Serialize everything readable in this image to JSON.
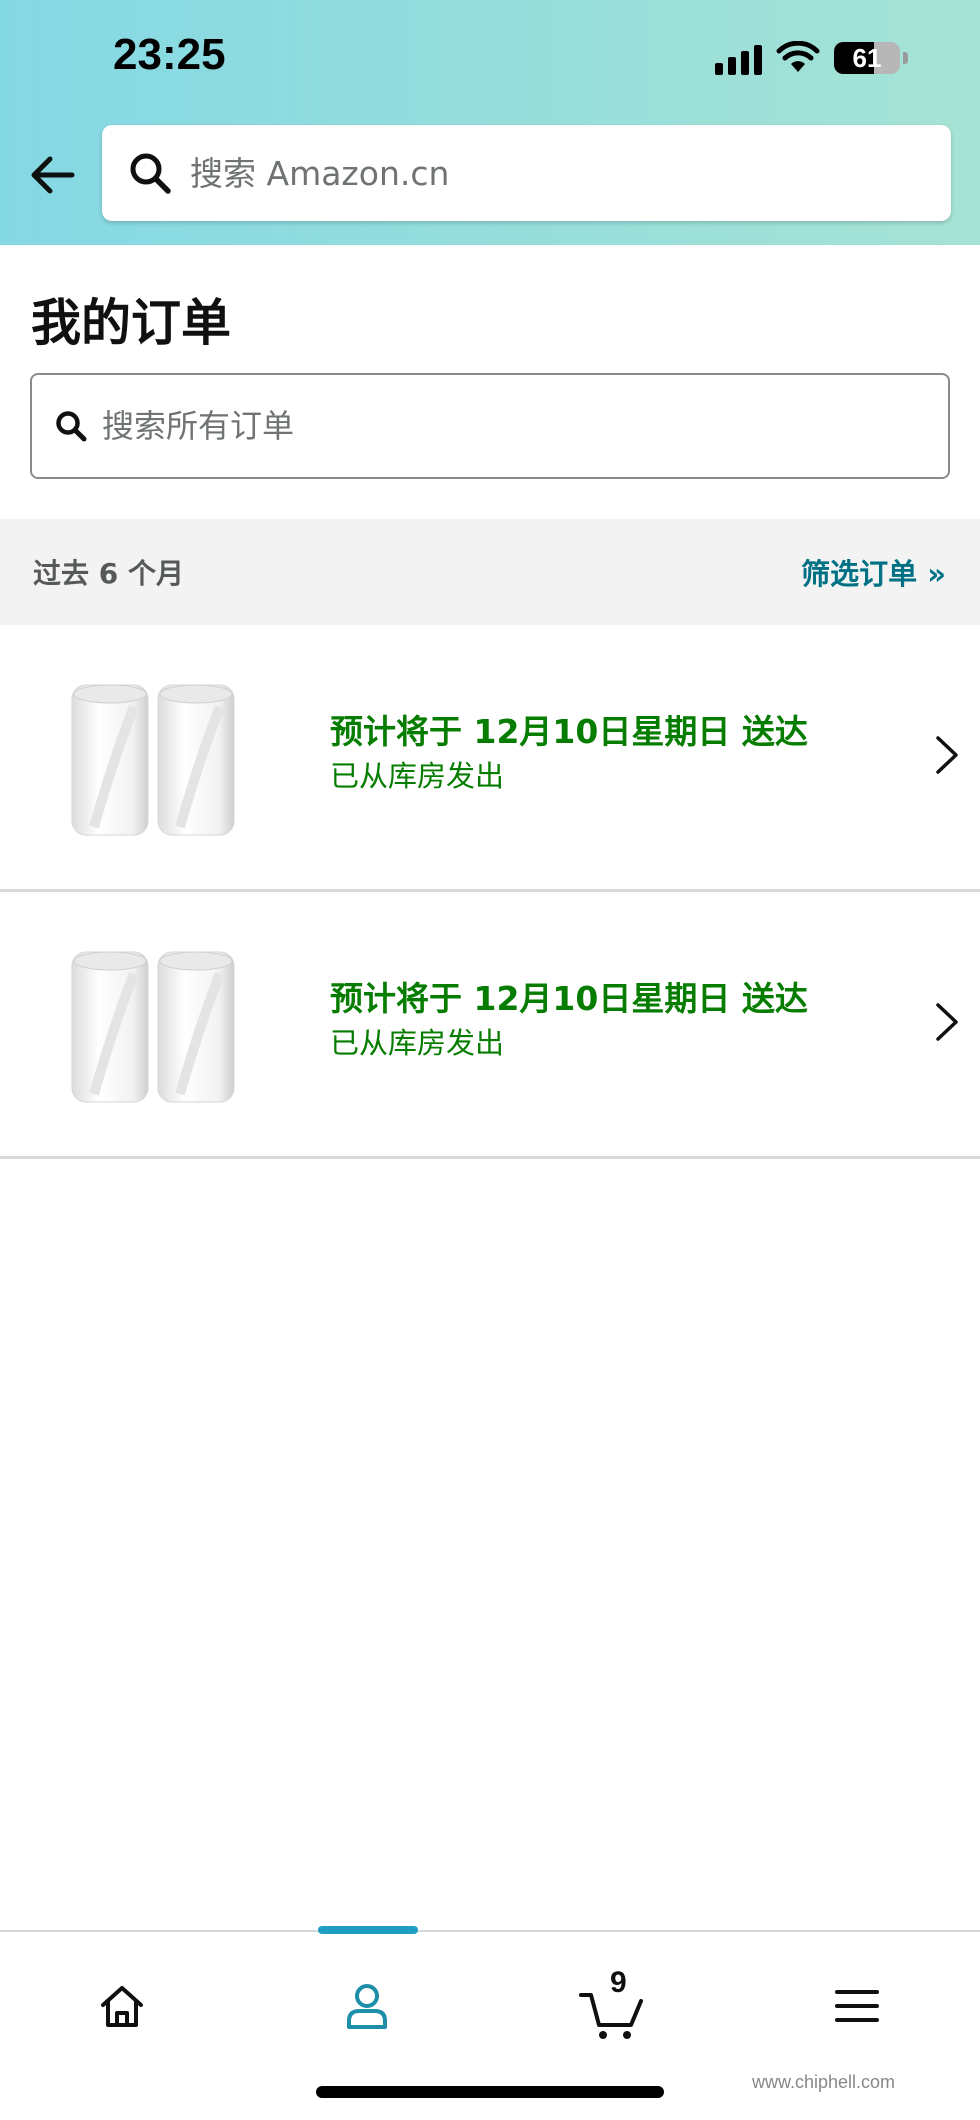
{
  "status_bar": {
    "time": "23:25",
    "battery": "61",
    "battery_level": 0.61
  },
  "header": {
    "search_placeholder": "搜索 Amazon.cn"
  },
  "page": {
    "title": "我的订单",
    "orders_search_placeholder": "搜索所有订单"
  },
  "filter": {
    "period": "过去 6 个月",
    "link": "筛选订单 »"
  },
  "orders": [
    {
      "status": "预计将于 12月10日星期日 送达",
      "substatus": "已从库房发出",
      "thumbnail": "mesh-wifi-router-2-pack"
    },
    {
      "status": "预计将于 12月10日星期日 送达",
      "substatus": "已从库房发出",
      "thumbnail": "mesh-wifi-router-2-pack"
    }
  ],
  "bottom_nav": {
    "items": [
      "home-icon",
      "account-icon",
      "cart-icon",
      "menu-icon"
    ],
    "active": "account-icon",
    "cart_count": "9"
  },
  "colors": {
    "header_gradient_start": "#84d8e4",
    "header_gradient_end": "#a6e3d4",
    "delivery_green": "#067d00",
    "link_teal": "#007185",
    "active_nav": "#1f8ea8"
  },
  "watermark": "www.chiphell.com"
}
